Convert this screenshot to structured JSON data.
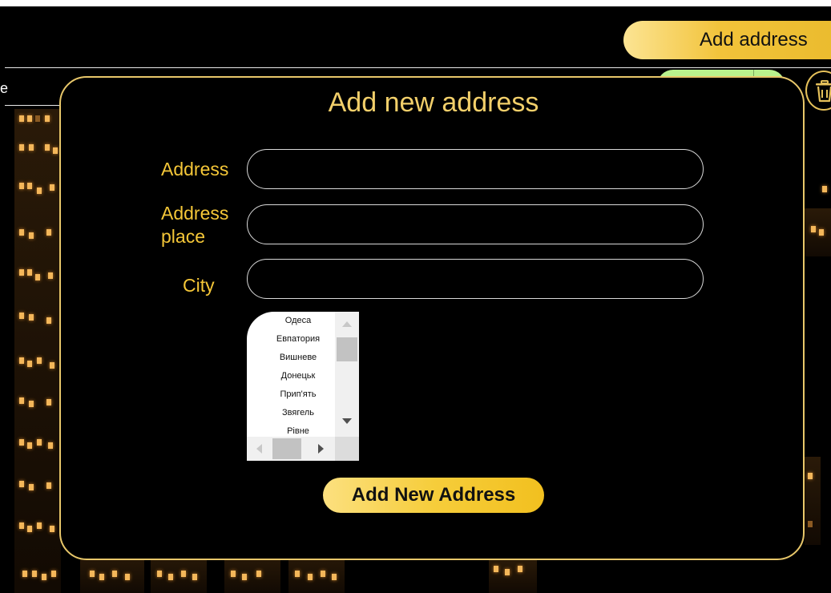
{
  "header": {
    "add_address_label": "Add address",
    "left_cut_text": "e"
  },
  "modal": {
    "title": "Add new address",
    "fields": {
      "address": {
        "label": "Address",
        "value": "",
        "placeholder": ""
      },
      "address_place": {
        "label": "Address place",
        "value": "",
        "placeholder": ""
      },
      "city": {
        "label": "City",
        "value": ""
      }
    },
    "city_options": [
      "Одеса",
      "Евпатория",
      "Вишневе",
      "Донецьк",
      "Прип'ять",
      "Звягель",
      "Рівне"
    ],
    "submit_label": "Add New Address"
  },
  "colors": {
    "accent_gold": "#f5c738",
    "modal_border": "#e8c76a",
    "green_pill": "#b9f28d",
    "background": "#000000"
  },
  "icons": [
    "trash-icon",
    "scroll-up-arrow-icon",
    "scroll-down-arrow-icon",
    "scroll-left-arrow-icon",
    "scroll-right-arrow-icon"
  ]
}
